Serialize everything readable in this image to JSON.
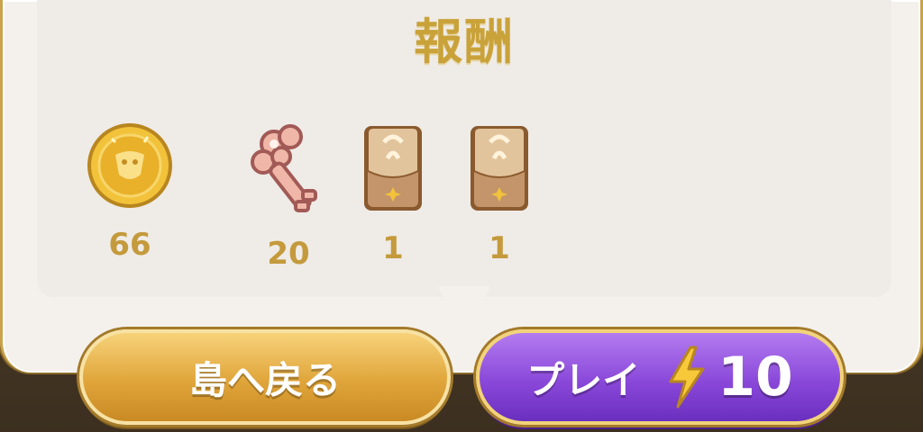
{
  "title": "報酬",
  "rewards": [
    {
      "name": "coin",
      "icon": "gold-coin-icon",
      "quantity": "66"
    },
    {
      "name": "key",
      "icon": "pink-key-icon",
      "quantity": "20"
    },
    {
      "name": "card-pack-1",
      "icon": "card-pack-icon",
      "quantity": "1"
    },
    {
      "name": "card-pack-2",
      "icon": "card-pack-icon",
      "quantity": "1"
    }
  ],
  "buttons": {
    "back_label": "島へ戻る",
    "play_label": "プレイ",
    "play_cost": "10",
    "play_cost_icon": "lightning-bolt-icon"
  },
  "colors": {
    "gold_text": "#c9a23a",
    "play_button": "#8a48d9",
    "back_button": "#e0a53a"
  }
}
